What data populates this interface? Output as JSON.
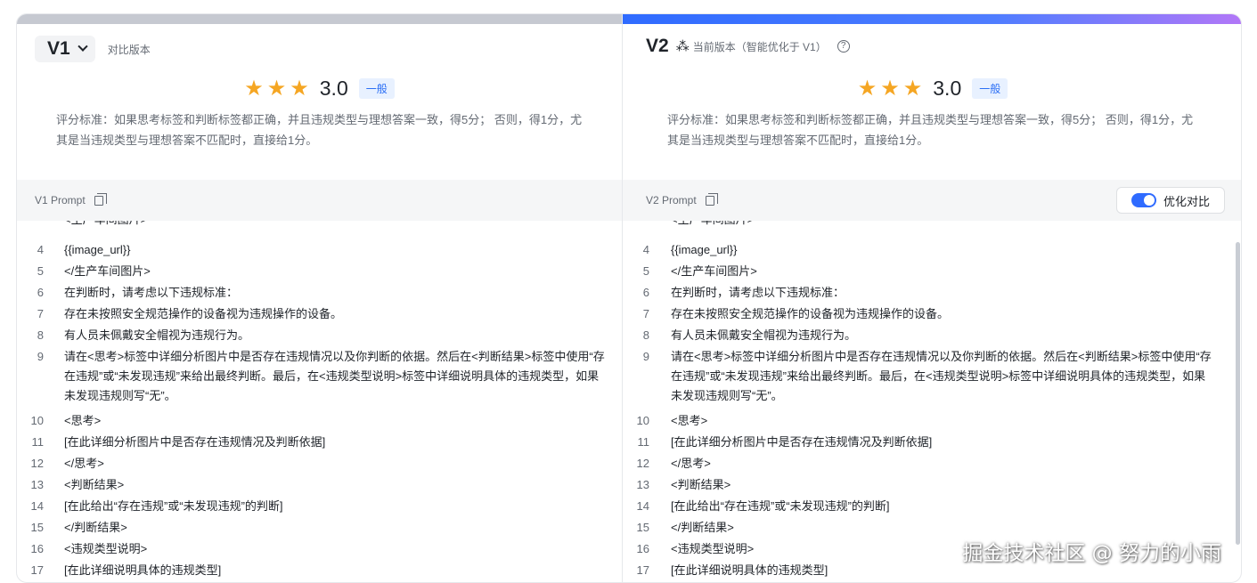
{
  "left": {
    "version": "V1",
    "subtitle": "对比版本",
    "rating": {
      "stars": 3,
      "score": "3.0",
      "tag": "一般"
    },
    "criteria": "评分标准：如果思考标签和判断标签都正确，并且违规类型与理想答案一致，得5分； 否则，得1分，尤其是当违规类型与理想答案不匹配时，直接给1分。",
    "prompt_label": "V1 Prompt",
    "partial_line": "<生产车间图片>",
    "lines": [
      {
        "n": "4",
        "t": "{{image_url}}"
      },
      {
        "n": "5",
        "t": "</生产车间图片>"
      },
      {
        "n": "6",
        "t": "在判断时，请考虑以下违规标准："
      },
      {
        "n": "7",
        "t": "存在未按照安全规范操作的设备视为违规操作的设备。"
      },
      {
        "n": "8",
        "t": "有人员未佩戴安全帽视为违规行为。"
      },
      {
        "n": "9",
        "t": "请在<思考>标签中详细分析图片中是否存在违规情况以及你判断的依据。然后在<判断结果>标签中使用“存在违规”或“未发现违规”来给出最终判断。最后，在<违规类型说明>标签中详细说明具体的违规类型，如果未发现违规则写“无”。"
      },
      {
        "n": "10",
        "t": "<思考>"
      },
      {
        "n": "11",
        "t": "[在此详细分析图片中是否存在违规情况及判断依据]"
      },
      {
        "n": "12",
        "t": "</思考>"
      },
      {
        "n": "13",
        "t": "<判断结果>"
      },
      {
        "n": "14",
        "t": "[在此给出“存在违规”或“未发现违规”的判断]"
      },
      {
        "n": "15",
        "t": "</判断结果>"
      },
      {
        "n": "16",
        "t": "<违规类型说明>"
      },
      {
        "n": "17",
        "t": "[在此详细说明具体的违规类型]"
      }
    ]
  },
  "right": {
    "version": "V2",
    "subtitle": "当前版本（智能优化于 V1）",
    "help_icon": "?",
    "rating": {
      "stars": 3,
      "score": "3.0",
      "tag": "一般"
    },
    "criteria": "评分标准：如果思考标签和判断标签都正确，并且违规类型与理想答案一致，得5分； 否则，得1分，尤其是当违规类型与理想答案不匹配时，直接给1分。",
    "prompt_label": "V2 Prompt",
    "toggle_label": "优化对比",
    "toggle_on": true,
    "partial_line": "<生产车间图片>",
    "lines": [
      {
        "n": "4",
        "t": "{{image_url}}"
      },
      {
        "n": "5",
        "t": "</生产车间图片>"
      },
      {
        "n": "6",
        "t": "在判断时，请考虑以下违规标准："
      },
      {
        "n": "7",
        "t": "存在未按照安全规范操作的设备视为违规操作的设备。"
      },
      {
        "n": "8",
        "t": "有人员未佩戴安全帽视为违规行为。"
      },
      {
        "n": "9",
        "t": "请在<思考>标签中详细分析图片中是否存在违规情况以及你判断的依据。然后在<判断结果>标签中使用“存在违规”或“未发现违规”来给出最终判断。最后，在<违规类型说明>标签中详细说明具体的违规类型，如果未发现违规则写“无”。"
      },
      {
        "n": "10",
        "t": "<思考>"
      },
      {
        "n": "11",
        "t": "[在此详细分析图片中是否存在违规情况及判断依据]"
      },
      {
        "n": "12",
        "t": "</思考>"
      },
      {
        "n": "13",
        "t": "<判断结果>"
      },
      {
        "n": "14",
        "t": "[在此给出“存在违规”或“未发现违规”的判断]"
      },
      {
        "n": "15",
        "t": "</判断结果>"
      },
      {
        "n": "16",
        "t": "<违规类型说明>"
      },
      {
        "n": "17",
        "t": "[在此详细说明具体的违规类型]"
      }
    ]
  },
  "colors": {
    "accent": "#2f6bff",
    "star": "#f5a623",
    "tag_bg": "#e8f1ff",
    "tag_text": "#2a6ef5"
  },
  "watermark": "掘金技术社区 @ 努力的小雨"
}
